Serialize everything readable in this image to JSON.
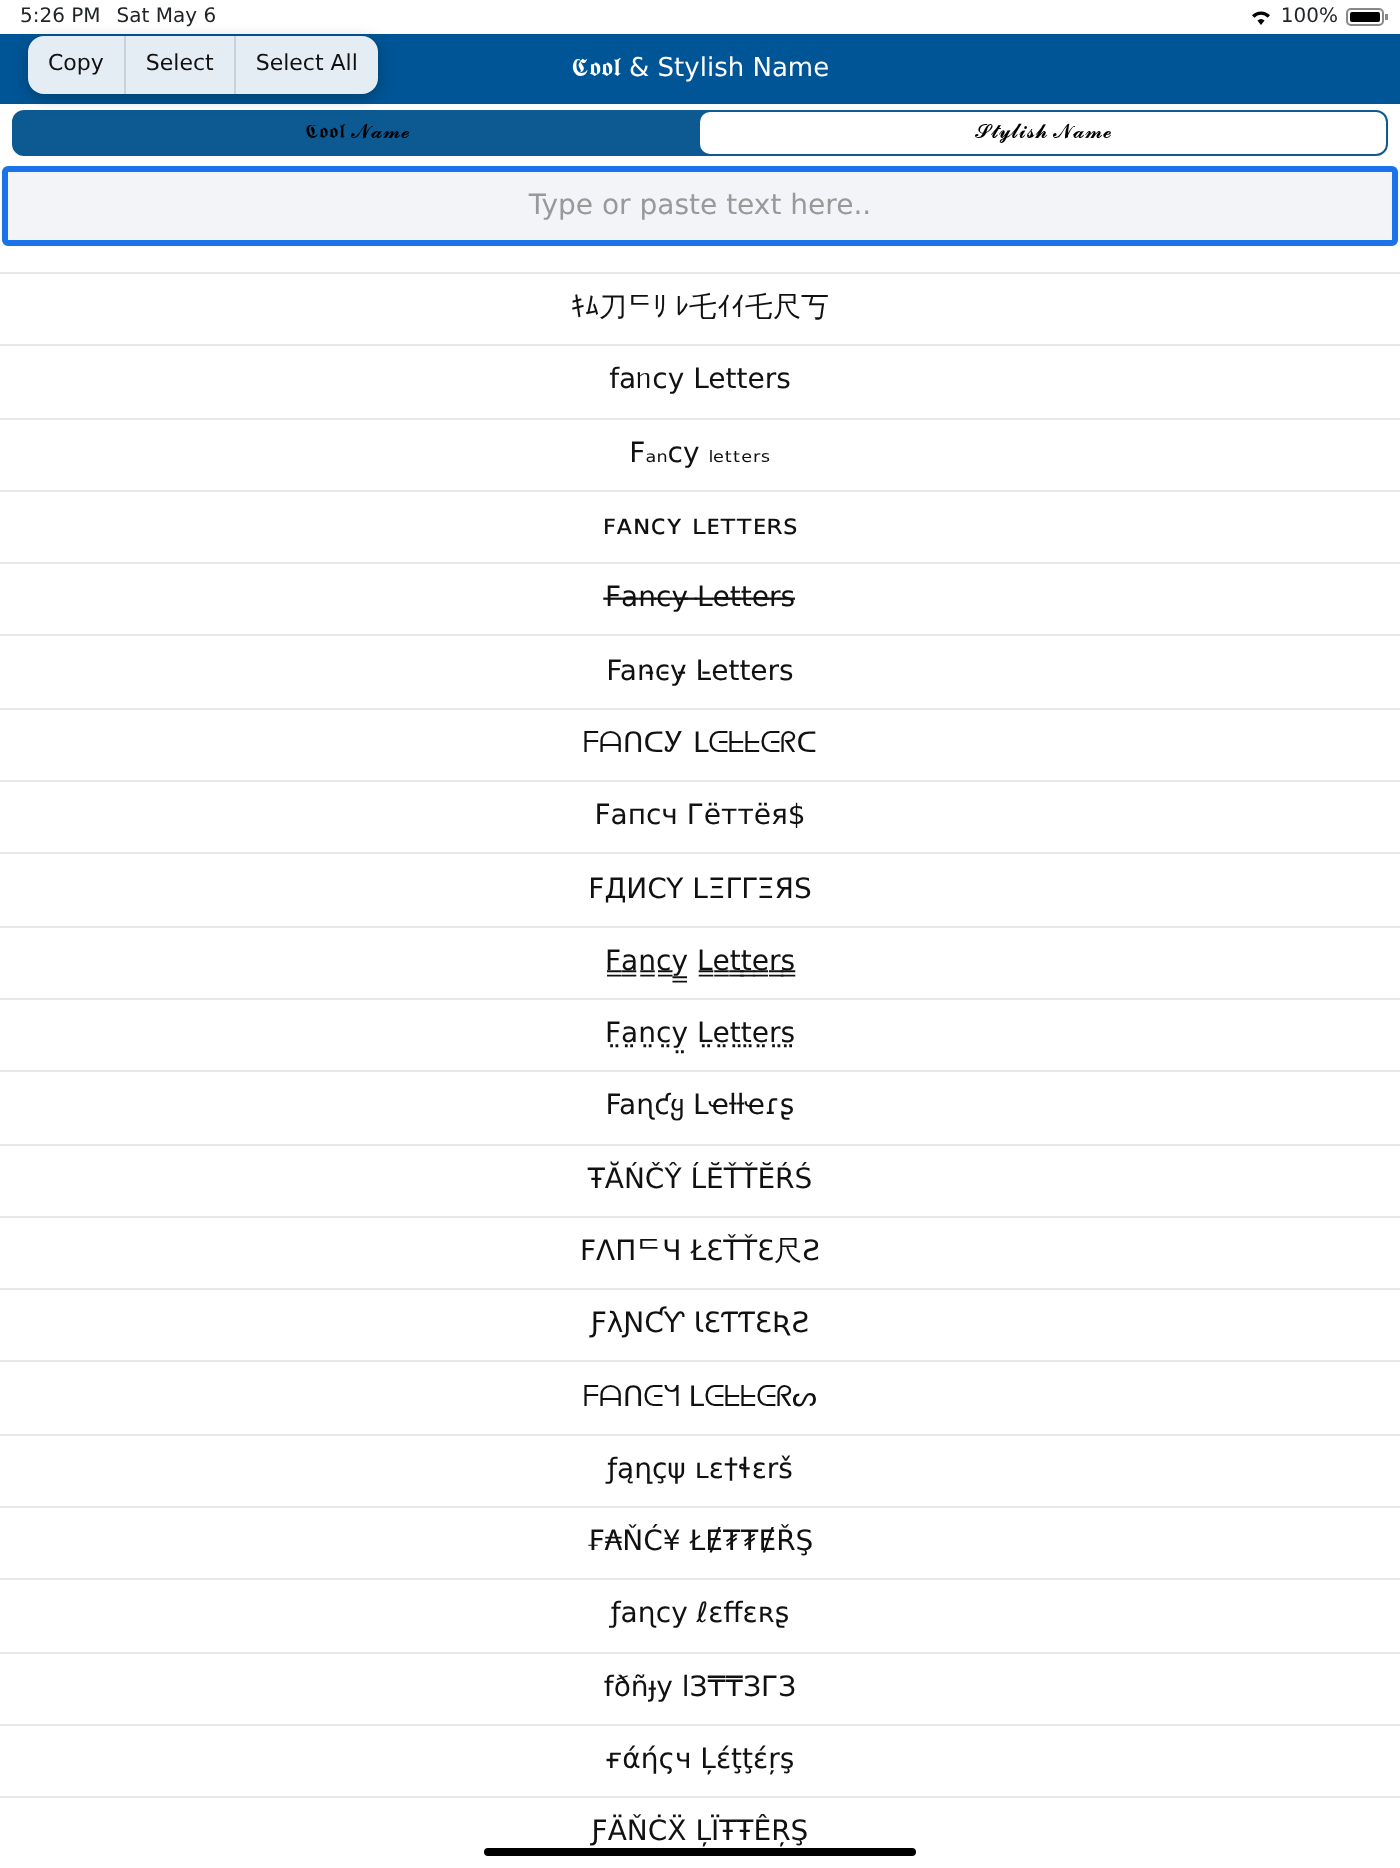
{
  "status_bar": {
    "time": "5:26 PM",
    "date": "Sat May 6",
    "battery": "100%"
  },
  "edit_menu": [
    "Copy",
    "Select",
    "Select All"
  ],
  "header": {
    "title": "𝕮𝖔𝖔𝖑 & Stylish Name"
  },
  "segments": [
    {
      "label": "𝕮𝖔𝖔𝖑 𝓝𝓪𝓶𝓮",
      "selected": false
    },
    {
      "label": "𝓢𝓽𝔂𝓵𝓲𝓼𝓱 𝓝𝓪𝓶𝓮",
      "selected": true
    }
  ],
  "search": {
    "placeholder": "Type or paste text here.."
  },
  "results": [
    "ｷﾑ刀ᄃﾘ ﾚ乇ｲｲ乇尺丂",
    "faᥒcy Letters",
    "Fₐₙcy ₗₑₜₜₑᵣₛ",
    "ꜰᴀɴᴄʏ ʟᴇᴛᴛᴇʀꜱ",
    "F̶a̶n̶c̶y̶ ̶L̶e̶t̶t̶e̶r̶s̶",
    "Fan̵c̵y̵ L̵etters",
    "ᖴᗩᑎᑕᎩ ᒪᕮᖶᖶᕮᖇᑕ",
    "Fапсч Гёттёя$",
    "FДИCY LΞΓΓΞЯS",
    "F̳a̳n̳c̳y̳ L̳e̳t̳t̳e̳r̳s̳",
    "F̤a̤n̤c̤y̤ L̤e̤t̤t̤e̤r̤s̤",
    "Faɳƈყ Lҽƚƚҽɾʂ",
    "ŦĂŃČŶ ĹĔŤŤĔŔŚ",
    "FΛПᄃЧ ŁƐŤŤƐ尺Ƨ",
    "ƑλƝƇƳ ƖƐƬƬƐƦƧ",
    "ᖴᗩᑎᕮᖻ ᒪᕮᖶᖶᕮᖇᔕ",
    "ƒąղçψ ʟɛ†ɬɛrš",
    "₣₳ŇĆ¥ ŁɆ₮₮ɆŘŞ",
    "ƒaɳcy ℓɛffɛʀʂ",
    "fðñɟy lЗ₸₸ЗГЗ",
    "ғάήςч Ļέţţέŗş",
    "ƑÄŇĊẌ ĻÏŦŦÊŖŞ"
  ]
}
